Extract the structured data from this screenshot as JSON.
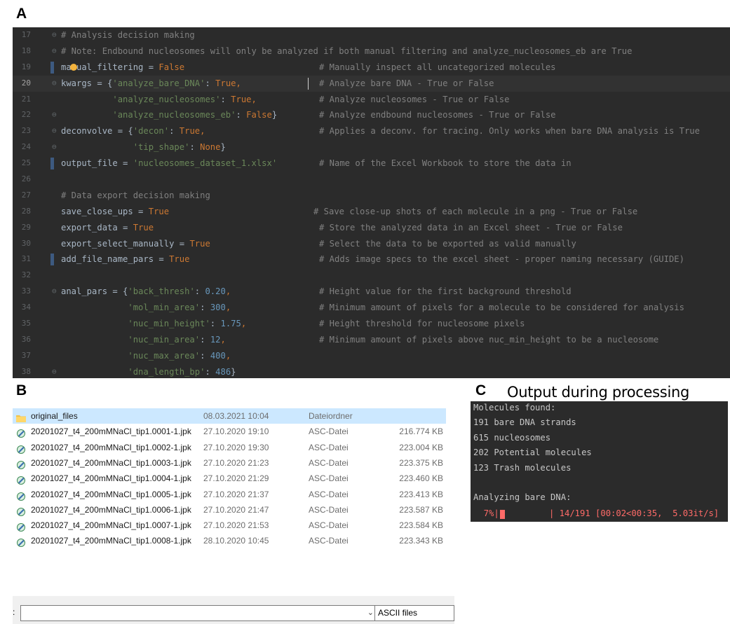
{
  "panels": {
    "a": "A",
    "b": "B",
    "c": "C"
  },
  "output_title": "Output during processing",
  "editor": {
    "lines": [
      {
        "num": "17",
        "fold": "⊖",
        "tokens": [
          {
            "t": "# Analysis decision making",
            "c": "c"
          }
        ]
      },
      {
        "num": "18",
        "fold": "⊖",
        "tokens": [
          {
            "t": "# Note: Endbound nucleosomes will only be analyzed if both manual filtering and analyze_nucleosomes_eb are True",
            "c": "c"
          }
        ]
      },
      {
        "num": "19",
        "bm": true,
        "bulb": true,
        "tokens": [
          {
            "t": "manual_filtering = ",
            "c": "var"
          },
          {
            "t": "False",
            "c": "kw"
          }
        ],
        "comment": "# Manually inspect all uncategorized molecules"
      },
      {
        "num": "20",
        "fold": "⊖",
        "current": true,
        "caret": true,
        "tokens": [
          {
            "t": "kwargs = {",
            "c": "var"
          },
          {
            "t": "'analyze_bare_DNA'",
            "c": "str"
          },
          {
            "t": ": ",
            "c": "var"
          },
          {
            "t": "True",
            "c": "kw"
          },
          {
            "t": ",",
            "c": "kw"
          }
        ],
        "comment": "# Analyze bare DNA - True or False"
      },
      {
        "num": "21",
        "tokens": [
          {
            "t": "          'analyze_nucleosomes'",
            "c": "str"
          },
          {
            "t": ": ",
            "c": "var"
          },
          {
            "t": "True",
            "c": "kw"
          },
          {
            "t": ",",
            "c": "kw"
          }
        ],
        "comment": "# Analyze nucleosomes - True or False"
      },
      {
        "num": "22",
        "fold": "⊖",
        "tokens": [
          {
            "t": "          'analyze_nucleosomes_eb'",
            "c": "str"
          },
          {
            "t": ": ",
            "c": "var"
          },
          {
            "t": "False",
            "c": "kw"
          },
          {
            "t": "}",
            "c": "var"
          }
        ],
        "comment": "# Analyze endbound nucleosomes - True or False"
      },
      {
        "num": "23",
        "fold": "⊖",
        "tokens": [
          {
            "t": "deconvolve = {",
            "c": "var"
          },
          {
            "t": "'decon'",
            "c": "str"
          },
          {
            "t": ": ",
            "c": "var"
          },
          {
            "t": "True",
            "c": "kw"
          },
          {
            "t": ",",
            "c": "kw"
          }
        ],
        "comment": "# Applies a deconv. for tracing. Only works when bare DNA analysis is True"
      },
      {
        "num": "24",
        "fold": "⊖",
        "tokens": [
          {
            "t": "              'tip_shape'",
            "c": "str"
          },
          {
            "t": ": ",
            "c": "var"
          },
          {
            "t": "None",
            "c": "kw"
          },
          {
            "t": "}",
            "c": "var"
          }
        ]
      },
      {
        "num": "25",
        "bm": true,
        "tokens": [
          {
            "t": "output_file = ",
            "c": "var"
          },
          {
            "t": "'nucleosomes_dataset_1.xlsx'",
            "c": "str"
          }
        ],
        "comment": "# Name of the Excel Workbook to store the data in"
      },
      {
        "num": "26",
        "tokens": []
      },
      {
        "num": "27",
        "tokens": [
          {
            "t": "# Data export decision making",
            "c": "c"
          }
        ]
      },
      {
        "num": "28",
        "tokens": [
          {
            "t": "save_close_ups = ",
            "c": "var"
          },
          {
            "t": "True",
            "c": "kw"
          }
        ],
        "comment": "# Save close-up shots of each molecule in a png - True or False",
        "cshift": -8
      },
      {
        "num": "29",
        "tokens": [
          {
            "t": "export_data = ",
            "c": "var"
          },
          {
            "t": "True",
            "c": "kw"
          }
        ],
        "comment": "# Store the analyzed data in an Excel sheet - True or False"
      },
      {
        "num": "30",
        "tokens": [
          {
            "t": "export_select_manually = ",
            "c": "var"
          },
          {
            "t": "True",
            "c": "kw"
          }
        ],
        "comment": "# Select the data to be exported as valid manually"
      },
      {
        "num": "31",
        "bm": true,
        "tokens": [
          {
            "t": "add_file_name_pars = ",
            "c": "var"
          },
          {
            "t": "True",
            "c": "kw"
          }
        ],
        "comment": "# Adds image specs to the excel sheet - proper naming necessary (GUIDE)"
      },
      {
        "num": "32",
        "tokens": []
      },
      {
        "num": "33",
        "fold": "⊖",
        "tokens": [
          {
            "t": "anal_pars = {",
            "c": "var"
          },
          {
            "t": "'back_thresh'",
            "c": "str"
          },
          {
            "t": ": ",
            "c": "var"
          },
          {
            "t": "0.20",
            "c": "num"
          },
          {
            "t": ",",
            "c": "kw"
          }
        ],
        "comment": "# Height value for the first background threshold"
      },
      {
        "num": "34",
        "tokens": [
          {
            "t": "             'mol_min_area'",
            "c": "str"
          },
          {
            "t": ": ",
            "c": "var"
          },
          {
            "t": "300",
            "c": "num"
          },
          {
            "t": ",",
            "c": "kw"
          }
        ],
        "comment": "# Minimum amount of pixels for a molecule to be considered for analysis"
      },
      {
        "num": "35",
        "tokens": [
          {
            "t": "             'nuc_min_height'",
            "c": "str"
          },
          {
            "t": ": ",
            "c": "var"
          },
          {
            "t": "1.75",
            "c": "num"
          },
          {
            "t": ",",
            "c": "kw"
          }
        ],
        "comment": "# Height threshold for nucleosome pixels"
      },
      {
        "num": "36",
        "tokens": [
          {
            "t": "             'nuc_min_area'",
            "c": "str"
          },
          {
            "t": ": ",
            "c": "var"
          },
          {
            "t": "12",
            "c": "num"
          },
          {
            "t": ",",
            "c": "kw"
          }
        ],
        "comment": "# Minimum amount of pixels above nuc_min_height to be a nucleosome"
      },
      {
        "num": "37",
        "tokens": [
          {
            "t": "             'nuc_max_area'",
            "c": "str"
          },
          {
            "t": ": ",
            "c": "var"
          },
          {
            "t": "400",
            "c": "num"
          },
          {
            "t": ",",
            "c": "kw"
          }
        ]
      },
      {
        "num": "38",
        "fold": "⊖",
        "tokens": [
          {
            "t": "             'dna_length_bp'",
            "c": "str"
          },
          {
            "t": ": ",
            "c": "var"
          },
          {
            "t": "486",
            "c": "num"
          },
          {
            "t": "}",
            "c": "var"
          }
        ]
      }
    ]
  },
  "explorer": {
    "rows": [
      {
        "name": "original_files",
        "date": "08.03.2021 10:04",
        "type": "Dateiordner",
        "size": "",
        "icon": "folder-icon",
        "selected": true
      },
      {
        "name": "20201027_t4_200mMNaCl_tip1.0001-1.jpk",
        "date": "27.10.2020 19:10",
        "type": "ASC-Datei",
        "size": "216.774 KB",
        "icon": "file-icon"
      },
      {
        "name": "20201027_t4_200mMNaCl_tip1.0002-1.jpk",
        "date": "27.10.2020 19:30",
        "type": "ASC-Datei",
        "size": "223.004 KB",
        "icon": "file-icon"
      },
      {
        "name": "20201027_t4_200mMNaCl_tip1.0003-1.jpk",
        "date": "27.10.2020 21:23",
        "type": "ASC-Datei",
        "size": "223.375 KB",
        "icon": "file-icon"
      },
      {
        "name": "20201027_t4_200mMNaCl_tip1.0004-1.jpk",
        "date": "27.10.2020 21:29",
        "type": "ASC-Datei",
        "size": "223.460 KB",
        "icon": "file-icon"
      },
      {
        "name": "20201027_t4_200mMNaCl_tip1.0005-1.jpk",
        "date": "27.10.2020 21:37",
        "type": "ASC-Datei",
        "size": "223.413 KB",
        "icon": "file-icon"
      },
      {
        "name": "20201027_t4_200mMNaCl_tip1.0006-1.jpk",
        "date": "27.10.2020 21:47",
        "type": "ASC-Datei",
        "size": "223.587 KB",
        "icon": "file-icon"
      },
      {
        "name": "20201027_t4_200mMNaCl_tip1.0007-1.jpk",
        "date": "27.10.2020 21:53",
        "type": "ASC-Datei",
        "size": "223.584 KB",
        "icon": "file-icon"
      },
      {
        "name": "20201027_t4_200mMNaCl_tip1.0008-1.jpk",
        "date": "28.10.2020 10:45",
        "type": "ASC-Datei",
        "size": "223.343 KB",
        "icon": "file-icon"
      }
    ],
    "filename_label": ":",
    "filename_value": "",
    "filetype": "ASCII files"
  },
  "terminal": {
    "lines": [
      "Molecules found:",
      "191 bare DNA strands",
      "615 nucleosomes",
      "202 Potential molecules",
      "123 Trash molecules",
      "",
      "Analyzing bare DNA:"
    ],
    "progress_percent": "7%|",
    "progress_fraction": 0.07,
    "progress_text": "| 14/191 [00:02<00:35,  5.03it/s]"
  }
}
